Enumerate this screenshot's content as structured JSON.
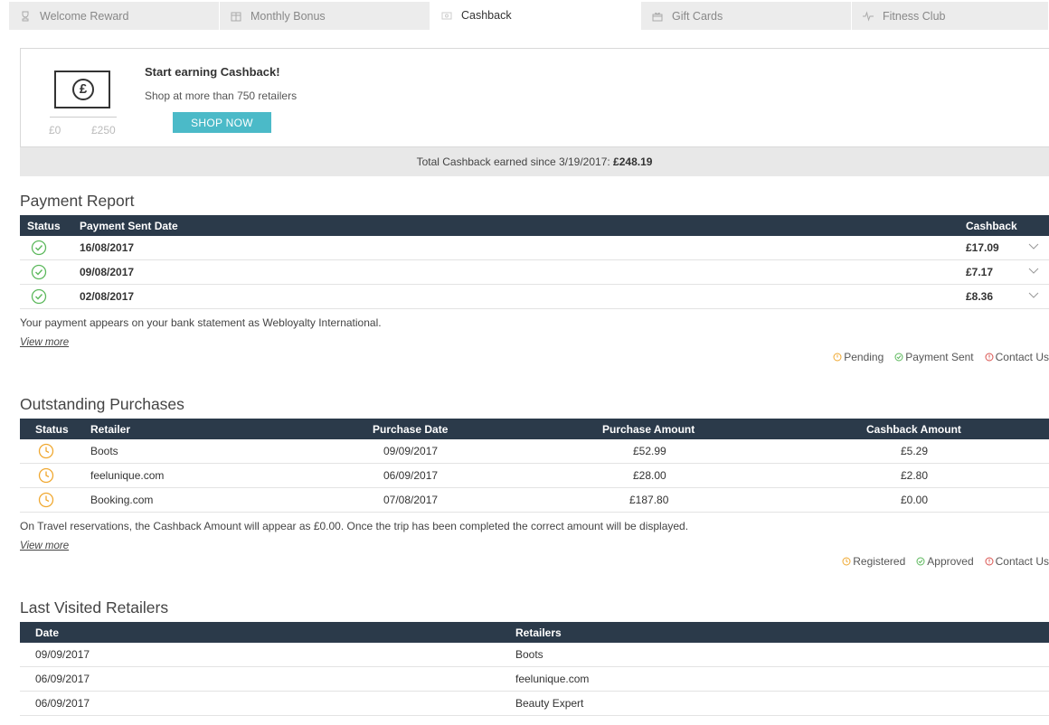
{
  "tabs": [
    {
      "label": "Welcome Reward",
      "icon": "trophy-icon"
    },
    {
      "label": "Monthly Bonus",
      "icon": "gift-calendar-icon"
    },
    {
      "label": "Cashback",
      "icon": "banknote-icon",
      "active": true
    },
    {
      "label": "Gift Cards",
      "icon": "gift-card-icon"
    },
    {
      "label": "Fitness Club",
      "icon": "heartbeat-icon"
    }
  ],
  "promo": {
    "currency_symbol": "£",
    "scale_min": "£0",
    "scale_max": "£250",
    "title": "Start earning Cashback!",
    "subtitle": "Shop at more than 750 retailers",
    "button": "SHOP NOW"
  },
  "total": {
    "label": "Total Cashback earned since 3/19/2017: ",
    "value": "£248.19"
  },
  "payment_report": {
    "title": "Payment Report",
    "headers": {
      "status": "Status",
      "date": "Payment Sent Date",
      "cashback": "Cashback"
    },
    "rows": [
      {
        "status": "payment-sent",
        "date": "16/08/2017",
        "cashback": "£17.09"
      },
      {
        "status": "payment-sent",
        "date": "09/08/2017",
        "cashback": "£7.17"
      },
      {
        "status": "payment-sent",
        "date": "02/08/2017",
        "cashback": "£8.36"
      }
    ],
    "note": "Your payment appears on your bank statement as Webloyalty International.",
    "view_more": "View more",
    "legend": {
      "pending": "Pending",
      "sent": "Payment Sent",
      "contact": "Contact Us"
    }
  },
  "outstanding": {
    "title": "Outstanding Purchases",
    "headers": {
      "status": "Status",
      "retailer": "Retailer",
      "date": "Purchase Date",
      "amount": "Purchase Amount",
      "cashback": "Cashback Amount"
    },
    "rows": [
      {
        "status": "registered",
        "retailer": "Boots",
        "date": "09/09/2017",
        "amount": "£52.99",
        "cashback": "£5.29"
      },
      {
        "status": "registered",
        "retailer": "feelunique.com",
        "date": "06/09/2017",
        "amount": "£28.00",
        "cashback": "£2.80"
      },
      {
        "status": "registered",
        "retailer": "Booking.com",
        "date": "07/08/2017",
        "amount": "£187.80",
        "cashback": "£0.00"
      }
    ],
    "note": "On Travel reservations, the Cashback Amount will appear as £0.00. Once the trip has been completed the correct amount will be displayed.",
    "view_more": "View more",
    "legend": {
      "registered": "Registered",
      "approved": "Approved",
      "contact": "Contact Us"
    }
  },
  "last_visited": {
    "title": "Last Visited Retailers",
    "headers": {
      "date": "Date",
      "retailers": "Retailers"
    },
    "rows": [
      {
        "date": "09/09/2017",
        "retailer": "Boots"
      },
      {
        "date": "06/09/2017",
        "retailer": "feelunique.com"
      },
      {
        "date": "06/09/2017",
        "retailer": "Beauty Expert"
      }
    ]
  },
  "colors": {
    "header_bg": "#2b3a4a",
    "accent_button": "#4bbac8",
    "status_green": "#5cb85c",
    "status_orange": "#f0a830",
    "status_red": "#d9534f"
  }
}
